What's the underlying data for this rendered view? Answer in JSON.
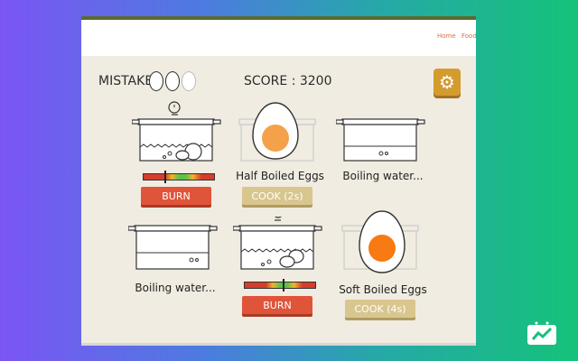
{
  "nav": {
    "home": "Home",
    "food": "Food"
  },
  "hud": {
    "mistake_label": "MISTAKE :",
    "score_label": "SCORE : 3200",
    "mistakes_used": 0,
    "mistakes_max": 3
  },
  "settings_icon": "gear-icon",
  "stations": [
    {
      "state": "cooking",
      "meter": 0.3,
      "button": "BURN"
    },
    {
      "state": "done",
      "caption": "Half Boiled Eggs",
      "button": "COOK (2s)"
    },
    {
      "state": "boiling",
      "caption": "Boiling water..."
    },
    {
      "state": "boiling",
      "caption": "Boiling water..."
    },
    {
      "state": "cooking",
      "meter": 0.55,
      "button": "BURN"
    },
    {
      "state": "done",
      "caption": "Soft Boiled Eggs",
      "button": "COOK (4s)"
    }
  ],
  "colors": {
    "burn": "#e0543a",
    "cook": "#d9c68e",
    "settings": "#d49b2e",
    "yolk_half": "#f5a14a",
    "yolk_soft": "#f77a12",
    "game_bg": "#f0ece1"
  }
}
